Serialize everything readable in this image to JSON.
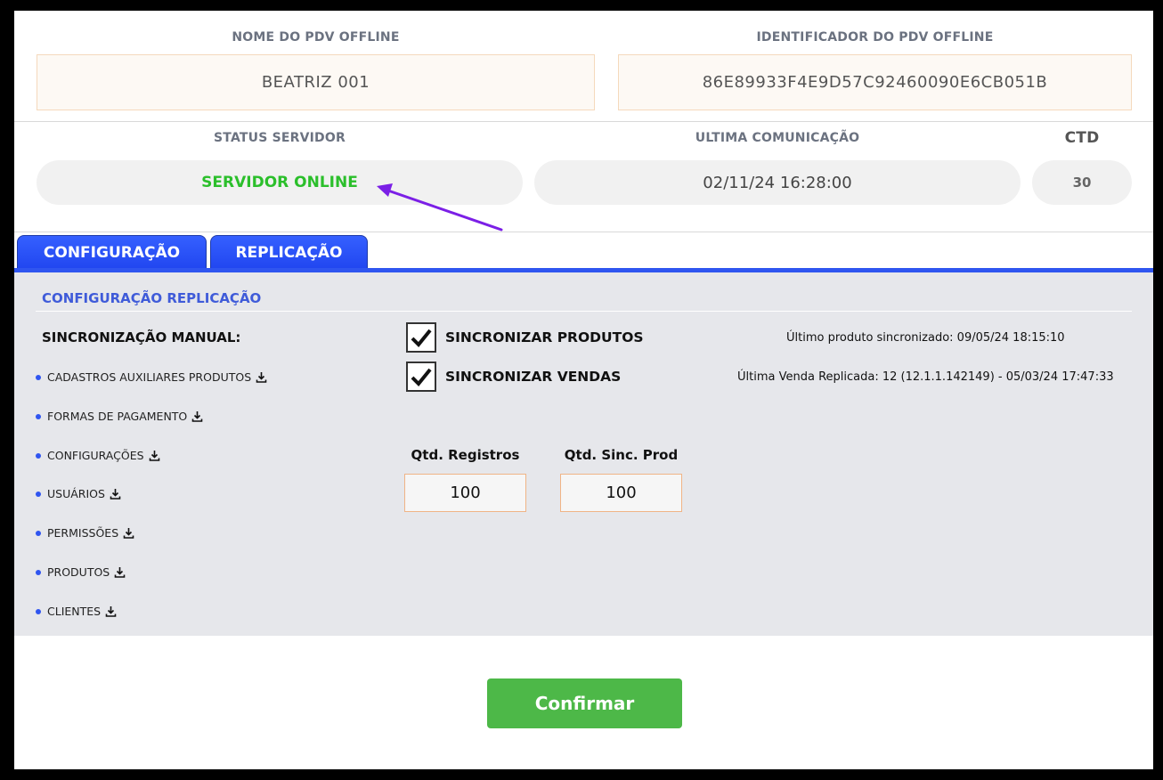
{
  "header": {
    "pdv_name_label": "NOME DO PDV OFFLINE",
    "pdv_name_value": "BEATRIZ 001",
    "pdv_id_label": "IDENTIFICADOR DO PDV OFFLINE",
    "pdv_id_value": "86E89933F4E9D57C92460090E6CB051B"
  },
  "status": {
    "server_label": "STATUS SERVIDOR",
    "server_value": "SERVIDOR ONLINE",
    "last_comm_label": "ULTIMA COMUNICAÇÃO",
    "last_comm_value": "02/11/24 16:28:00",
    "ctd_label": "CTD",
    "ctd_value": "30",
    "online_color": "#2bbf2b",
    "annotation_arrow_color": "#7b1fe6"
  },
  "tabs": [
    {
      "label": "CONFIGURAÇÃO",
      "active": false
    },
    {
      "label": "REPLICAÇÃO",
      "active": true
    }
  ],
  "replication": {
    "section_title": "CONFIGURAÇÃO REPLICAÇÃO",
    "manual_title": "SINCRONIZAÇÃO MANUAL:",
    "manual_items": [
      {
        "label": "CADASTROS AUXILIARES PRODUTOS",
        "icon": "download-icon"
      },
      {
        "label": "FORMAS DE PAGAMENTO",
        "icon": "download-icon"
      },
      {
        "label": "CONFIGURAÇÕES",
        "icon": "download-icon"
      },
      {
        "label": "USUÁRIOS",
        "icon": "download-icon"
      },
      {
        "label": "PERMISSÕES",
        "icon": "download-icon"
      },
      {
        "label": "PRODUTOS",
        "icon": "download-icon"
      },
      {
        "label": "CLIENTES",
        "icon": "download-icon"
      }
    ],
    "sync_products": {
      "label": "SINCRONIZAR PRODUTOS",
      "checked": true
    },
    "sync_sales": {
      "label": "SINCRONIZAR VENDAS",
      "checked": true
    },
    "last_product_info": "Último produto sincronizado: 09/05/24 18:15:10",
    "last_sale_info": "Última Venda Replicada: 12 (12.1.1.142149) - 05/03/24 17:47:33",
    "qtd_registros_label": "Qtd. Registros",
    "qtd_registros_value": "100",
    "qtd_sinc_prod_label": "Qtd. Sinc. Prod",
    "qtd_sinc_prod_value": "100"
  },
  "actions": {
    "confirm_label": "Confirmar"
  }
}
